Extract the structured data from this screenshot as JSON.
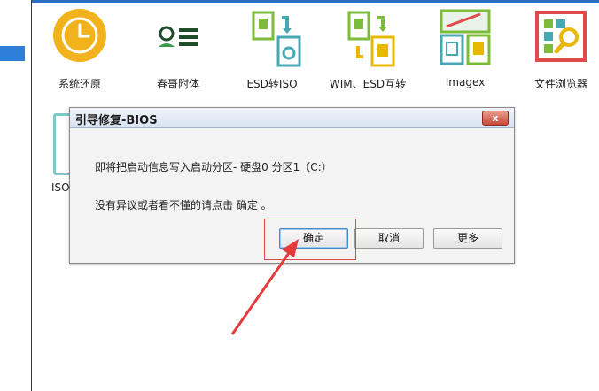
{
  "toolbar": {
    "items": [
      {
        "label": "系统还原",
        "icon": "clock-icon"
      },
      {
        "label": "春哥附体",
        "icon": "user-list-icon"
      },
      {
        "label": "ESD转ISO",
        "icon": "convert-document-icon"
      },
      {
        "label": "WIM、ESD互转",
        "icon": "swap-documents-icon"
      },
      {
        "label": "Imagex",
        "icon": "disk-image-icon"
      },
      {
        "label": "文件浏览器",
        "icon": "file-browser-icon"
      }
    ],
    "partial_label": "ISO"
  },
  "dialog": {
    "title": "引导修复-BIOS",
    "close_label": "x",
    "message1": "即将把启动信息写入启动分区- 硬盘0 分区1（C:）",
    "message2": "没有异议或者看不懂的请点击 确定 。",
    "buttons": {
      "ok": "确定",
      "cancel": "取消",
      "more": "更多"
    }
  },
  "colors": {
    "accent": "#2b6fc2",
    "annotation": "#e14a4a",
    "clock": "#f2b21b",
    "green": "#7dbb3a",
    "teal": "#47a8b4"
  }
}
